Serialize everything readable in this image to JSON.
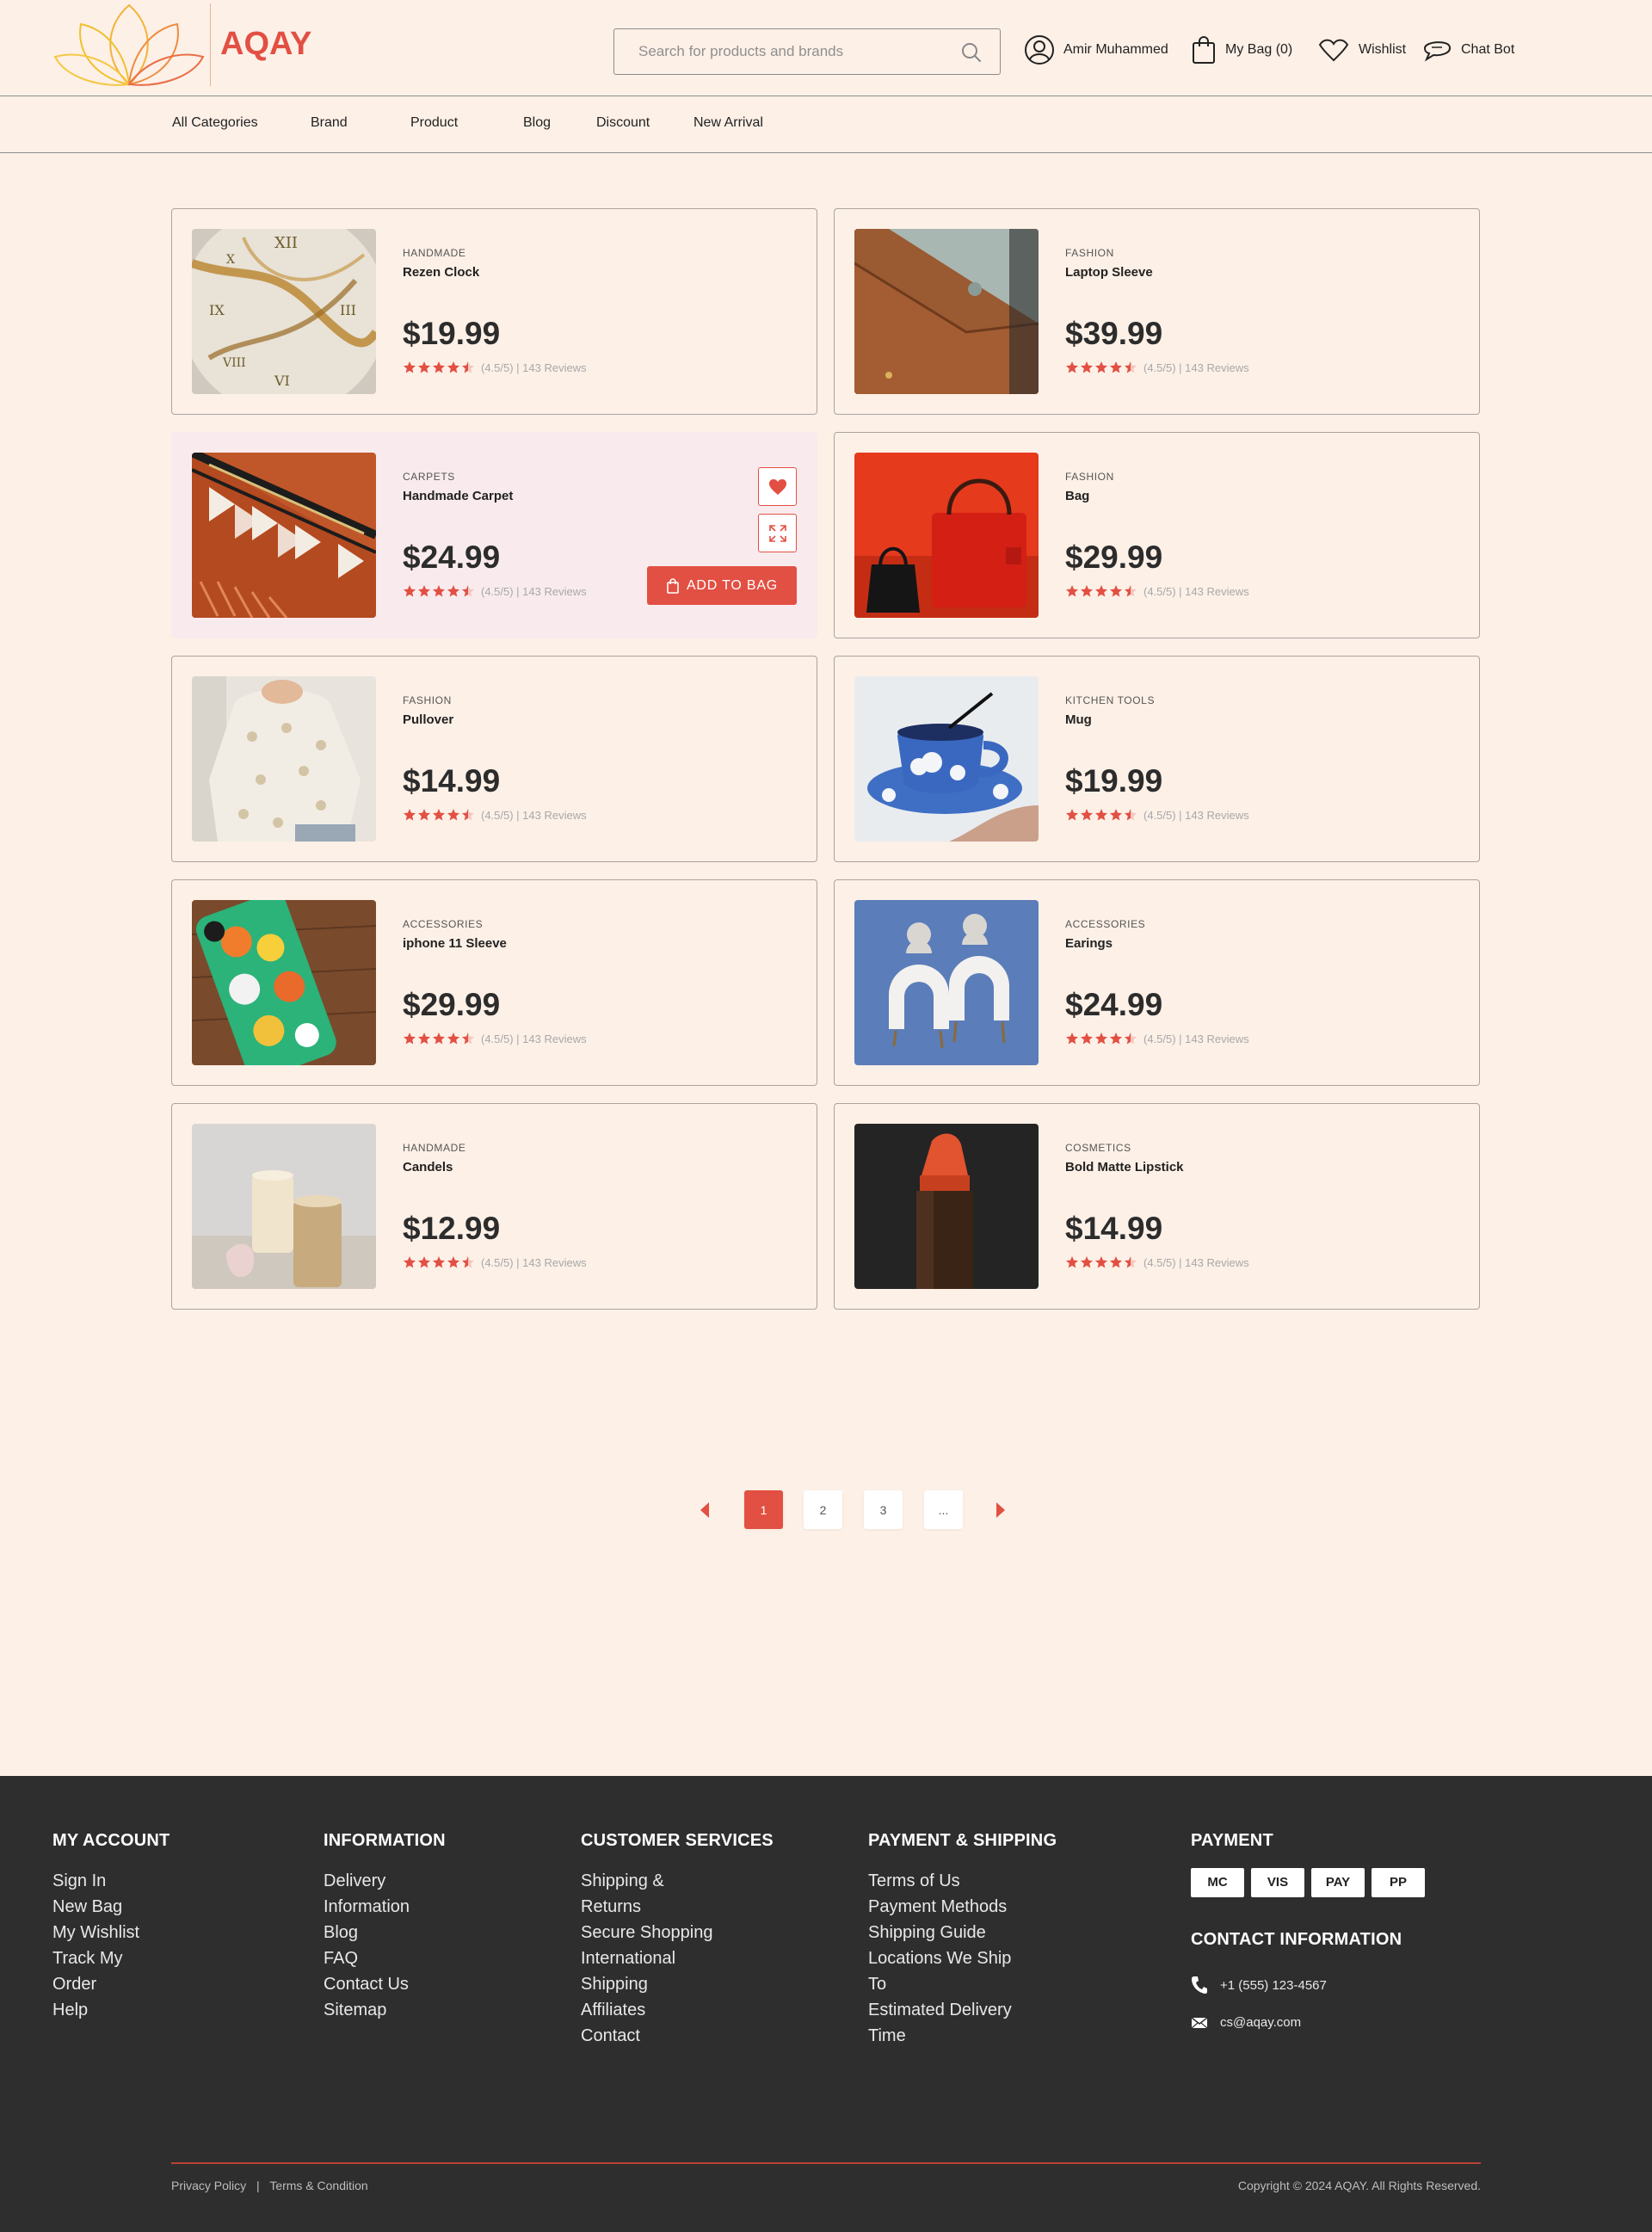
{
  "brand": {
    "name": "AQAY",
    "accent": "#e25043"
  },
  "search": {
    "placeholder": "Search for products and brands"
  },
  "header": {
    "user_name": "Amir Muhammed",
    "bag_label": "My Bag (0)",
    "wishlist_label": "Wishlist",
    "chatbot_label": "Chat Bot"
  },
  "nav": {
    "items": [
      {
        "label": "All Categories"
      },
      {
        "label": "Brand"
      },
      {
        "label": "Product"
      },
      {
        "label": "Blog"
      },
      {
        "label": "Discount"
      },
      {
        "label": "New Arrival"
      }
    ]
  },
  "products": [
    {
      "category": "HANDMADE",
      "name": "Rezen Clock",
      "price": "$19.99",
      "rating": 4.5,
      "rating_text": "(4.5/5) | 143 Reviews",
      "image": "clock"
    },
    {
      "category": "FASHION",
      "name": "Laptop Sleeve",
      "price": "$39.99",
      "rating": 4.5,
      "rating_text": "(4.5/5) | 143 Reviews",
      "image": "laptop-sleeve"
    },
    {
      "category": "CARPETS",
      "name": "Handmade Carpet",
      "price": "$24.99",
      "rating": 4.5,
      "rating_text": "(4.5/5) | 143 Reviews",
      "image": "carpet"
    },
    {
      "category": "FASHION",
      "name": "Bag",
      "price": "$29.99",
      "rating": 4.5,
      "rating_text": "(4.5/5) | 143 Reviews",
      "image": "bag"
    },
    {
      "category": "FASHION",
      "name": "Pullover",
      "price": "$14.99",
      "rating": 4.5,
      "rating_text": "(4.5/5) | 143 Reviews",
      "image": "pullover"
    },
    {
      "category": "KITCHEN TOOLS",
      "name": "Mug",
      "price": "$19.99",
      "rating": 4.5,
      "rating_text": "(4.5/5) | 143 Reviews",
      "image": "mug"
    },
    {
      "category": "ACCESSORIES",
      "name": "iphone 11 Sleeve",
      "price": "$29.99",
      "rating": 4.5,
      "rating_text": "(4.5/5) | 143 Reviews",
      "image": "phone-case"
    },
    {
      "category": "ACCESSORIES",
      "name": "Earings",
      "price": "$24.99",
      "rating": 4.5,
      "rating_text": "(4.5/5) | 143 Reviews",
      "image": "earrings"
    },
    {
      "category": "HANDMADE",
      "name": "Candels",
      "price": "$12.99",
      "rating": 4.5,
      "rating_text": "(4.5/5) | 143 Reviews",
      "image": "candles"
    },
    {
      "category": "COSMETICS",
      "name": "Bold Matte Lipstick",
      "price": "$14.99",
      "rating": 4.5,
      "rating_text": "(4.5/5) | 143 Reviews",
      "image": "lipstick"
    }
  ],
  "hover_card": {
    "add_to_bag_label": "ADD TO BAG"
  },
  "pagination": {
    "pages": [
      "1",
      "2",
      "3",
      "..."
    ],
    "current": "1"
  },
  "footer": {
    "my_account": {
      "title": "MY ACCOUNT",
      "links": [
        "Sign In",
        "New Bag",
        "My Wishlist",
        "Track My",
        "Order",
        "Help"
      ]
    },
    "information": {
      "title": "INFORMATION",
      "links": [
        "Delivery",
        "Information",
        "Blog",
        "FAQ",
        "Contact Us",
        "Sitemap"
      ]
    },
    "customer_services": {
      "title": "CUSTOMER SERVICES",
      "links": [
        "Shipping &",
        "Returns",
        "Secure Shopping",
        "International",
        "Shipping",
        "Affiliates",
        "Contact"
      ]
    },
    "payment_shipping": {
      "title": "PAYMENT & SHIPPING",
      "links": [
        "Terms of Us",
        "Payment Methods",
        "Shipping Guide",
        "Locations We Ship",
        "To",
        "Estimated Delivery",
        "Time"
      ]
    },
    "payment": {
      "title": "PAYMENT",
      "badges": [
        "MC",
        "VIS",
        "PAY",
        "PP"
      ]
    },
    "contact": {
      "title": "CONTACT INFORMATION",
      "phone": "+1 (555) 123-4567",
      "email": "cs@aqay.com"
    },
    "privacy_label": "Privacy Policy",
    "separator": "|",
    "terms_label": "Terms & Condition",
    "copyright": "Copyright © 2024 AQAY. All Rights Reserved."
  }
}
